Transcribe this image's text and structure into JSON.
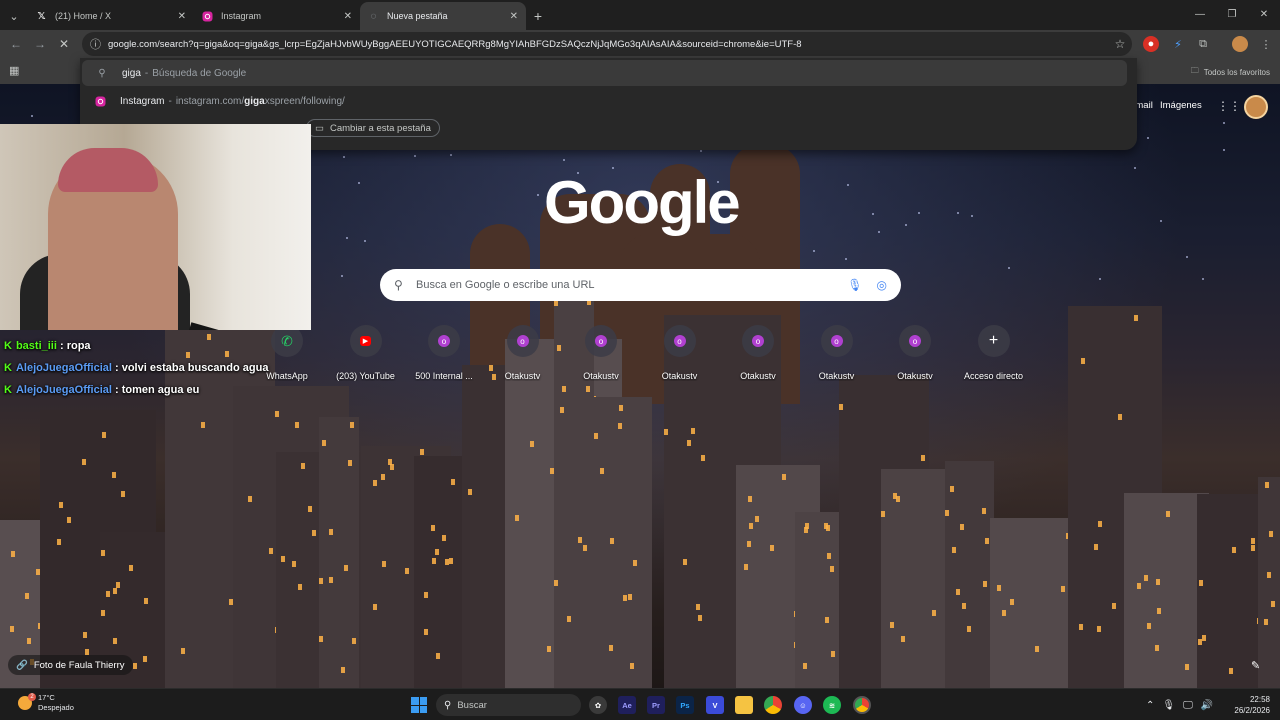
{
  "tabs": [
    {
      "title": "(21) Home / X",
      "icon": "x-logo-icon",
      "active": false
    },
    {
      "title": "Instagram",
      "icon": "instagram-icon",
      "active": false
    },
    {
      "title": "Nueva pestaña",
      "icon": "loading-icon",
      "active": true
    }
  ],
  "omnibox": {
    "url": "google.com/search?q=giga&oq=giga&gs_lcrp=EgZjaHJvbWUyBggAEEUYOTIGCAEQRRg8MgYIAhBFGDzSAQczNjJqMGo3qAIAsAIA&sourceid=chrome&ie=UTF-8"
  },
  "bookmarks": {
    "all_label": "Todos los favoritos"
  },
  "dropdown": {
    "suggestion1": {
      "main": "giga",
      "sep": "-",
      "sub": "Búsqueda de Google"
    },
    "suggestion2": {
      "main": "Instagram",
      "sep": "-",
      "sub_prefix": "instagram.com/",
      "sub_bold": "giga",
      "sub_suffix": "xspreen/following/"
    },
    "switch_tab": "Cambiar a esta pestaña"
  },
  "google": {
    "logo": "Google",
    "search_placeholder": "Busca en Google o escribe una URL",
    "top_links": {
      "gmail": "Gmail",
      "images": "Imágenes"
    }
  },
  "shortcuts": [
    {
      "label": "WhatsApp",
      "icon": "whatsapp-icon"
    },
    {
      "label": "(203) YouTube",
      "icon": "youtube-icon"
    },
    {
      "label": "500 Internal ...",
      "icon": "o-icon"
    },
    {
      "label": "Otakustv",
      "icon": "o-icon"
    },
    {
      "label": "Otakustv",
      "icon": "o-icon"
    },
    {
      "label": "Otakustv",
      "icon": "o-icon"
    },
    {
      "label": "Otakustv",
      "icon": "o-icon"
    },
    {
      "label": "Otakustv",
      "icon": "o-icon"
    },
    {
      "label": "Otakustv",
      "icon": "o-icon"
    },
    {
      "label": "Acceso directo",
      "icon": "plus-icon"
    }
  ],
  "chat": [
    {
      "user": "basti_iii",
      "text": ": ropa",
      "color": "#53fc18"
    },
    {
      "user": "AlejoJuegaOfficial",
      "text": ": volvi estaba buscando agua",
      "color": "#5b9cf5"
    },
    {
      "user": "AlejoJuegaOfficial",
      "text": ": tomen agua eu",
      "color": "#5b9cf5"
    }
  ],
  "photo_credit": "Foto de Faula Thierry",
  "taskbar": {
    "weather_temp": "17°C",
    "weather_desc": "Despejado",
    "weather_badge": "2",
    "search_label": "Buscar",
    "time": "22:58",
    "date": "26/2/2026"
  }
}
